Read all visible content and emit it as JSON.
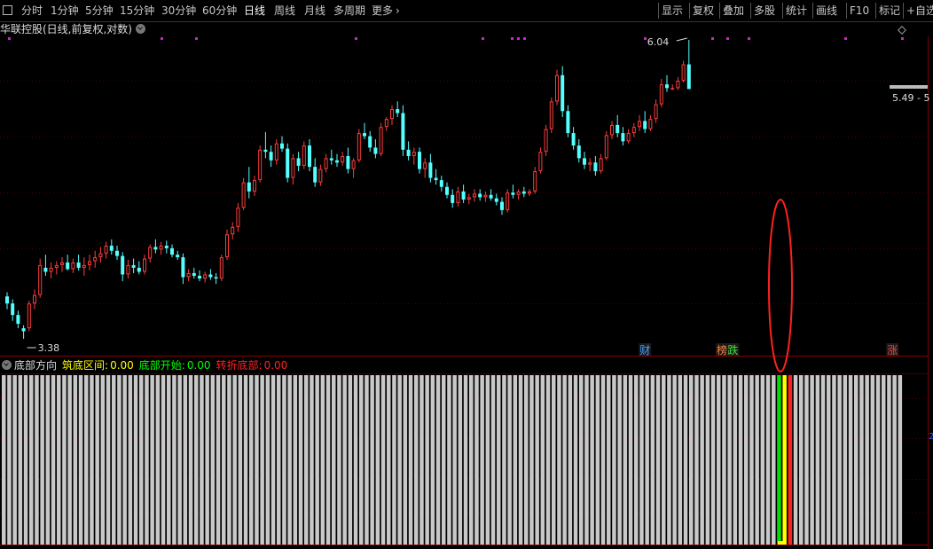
{
  "toolbar": {
    "periods": [
      {
        "label": "分时",
        "active": false
      },
      {
        "label": "1分钟",
        "active": false
      },
      {
        "label": "5分钟",
        "active": false
      },
      {
        "label": "15分钟",
        "active": false
      },
      {
        "label": "30分钟",
        "active": false
      },
      {
        "label": "60分钟",
        "active": false
      },
      {
        "label": "日线",
        "active": true
      },
      {
        "label": "周线",
        "active": false
      },
      {
        "label": "月线",
        "active": false
      },
      {
        "label": "多周期",
        "active": false
      },
      {
        "label": "更多",
        "active": false
      }
    ],
    "tools": [
      "显示",
      "复权",
      "叠加",
      "多股",
      "统计",
      "画线",
      "F10",
      "标记",
      "+自选"
    ]
  },
  "chart_title": "华联控股(日线,前复权,对数)",
  "indicator": {
    "name": "底部方向",
    "items": [
      {
        "label": "筑底区间:",
        "value": "0.00",
        "color": "#ffff00"
      },
      {
        "label": "底部开始:",
        "value": "0.00",
        "color": "#00ff00"
      },
      {
        "label": "转折底部:",
        "value": "0.00",
        "color": "#ff2020"
      }
    ]
  },
  "colors": {
    "up": "#ff3c3c",
    "down": "#54ffff",
    "grid": "#4a0000",
    "marker": "#d020d0"
  },
  "chart_data": {
    "type": "candlestick",
    "log_scale": true,
    "y_min": 3.38,
    "y_max": 6.04,
    "annotations": {
      "low_label": "3.38",
      "high_label": "6.04",
      "price_tag": "5.49 - 5"
    },
    "event_tags": [
      {
        "label": "财",
        "index": 116
      },
      {
        "label": "榜",
        "index": 130
      },
      {
        "label": "跌",
        "index": 132
      },
      {
        "label": "涨",
        "index": 161
      }
    ],
    "candles": [
      [
        3.67,
        3.7,
        3.58,
        3.62
      ],
      [
        3.62,
        3.65,
        3.5,
        3.54
      ],
      [
        3.54,
        3.57,
        3.45,
        3.48
      ],
      [
        3.45,
        3.47,
        3.38,
        3.43
      ],
      [
        3.45,
        3.64,
        3.43,
        3.62
      ],
      [
        3.62,
        3.72,
        3.58,
        3.68
      ],
      [
        3.68,
        3.95,
        3.66,
        3.9
      ],
      [
        3.88,
        3.98,
        3.82,
        3.85
      ],
      [
        3.85,
        3.92,
        3.8,
        3.88
      ],
      [
        3.88,
        3.93,
        3.83,
        3.9
      ],
      [
        3.9,
        3.96,
        3.85,
        3.92
      ],
      [
        3.92,
        3.98,
        3.86,
        3.87
      ],
      [
        3.87,
        3.95,
        3.84,
        3.92
      ],
      [
        3.92,
        3.98,
        3.86,
        3.88
      ],
      [
        3.88,
        3.96,
        3.82,
        3.9
      ],
      [
        3.9,
        3.98,
        3.86,
        3.93
      ],
      [
        3.93,
        4.01,
        3.88,
        3.96
      ],
      [
        3.96,
        4.04,
        3.92,
        3.99
      ],
      [
        3.99,
        4.08,
        3.95,
        4.05
      ],
      [
        4.05,
        4.1,
        3.98,
        4.01
      ],
      [
        4.01,
        4.05,
        3.94,
        3.97
      ],
      [
        3.97,
        4.0,
        3.78,
        3.83
      ],
      [
        3.83,
        3.94,
        3.8,
        3.9
      ],
      [
        3.9,
        3.95,
        3.84,
        3.88
      ],
      [
        3.88,
        3.93,
        3.83,
        3.85
      ],
      [
        3.85,
        3.98,
        3.83,
        3.95
      ],
      [
        3.95,
        4.06,
        3.92,
        4.04
      ],
      [
        4.04,
        4.1,
        3.99,
        4.02
      ],
      [
        4.02,
        4.08,
        3.98,
        4.05
      ],
      [
        4.05,
        4.09,
        3.99,
        4.03
      ],
      [
        4.03,
        4.06,
        3.96,
        3.98
      ],
      [
        3.98,
        4.01,
        3.94,
        3.96
      ],
      [
        3.96,
        3.99,
        3.76,
        3.81
      ],
      [
        3.81,
        3.87,
        3.78,
        3.84
      ],
      [
        3.84,
        3.88,
        3.8,
        3.82
      ],
      [
        3.82,
        3.86,
        3.78,
        3.8
      ],
      [
        3.8,
        3.85,
        3.77,
        3.83
      ],
      [
        3.83,
        3.87,
        3.79,
        3.81
      ],
      [
        3.81,
        3.84,
        3.76,
        3.8
      ],
      [
        3.8,
        3.98,
        3.78,
        3.96
      ],
      [
        3.96,
        4.18,
        3.94,
        4.14
      ],
      [
        4.14,
        4.24,
        4.1,
        4.2
      ],
      [
        4.2,
        4.4,
        4.16,
        4.36
      ],
      [
        4.36,
        4.62,
        4.34,
        4.58
      ],
      [
        4.58,
        4.72,
        4.44,
        4.5
      ],
      [
        4.5,
        4.64,
        4.46,
        4.6
      ],
      [
        4.6,
        4.92,
        4.58,
        4.88
      ],
      [
        4.88,
        5.05,
        4.8,
        4.86
      ],
      [
        4.86,
        4.92,
        4.72,
        4.78
      ],
      [
        4.78,
        4.98,
        4.74,
        4.94
      ],
      [
        4.94,
        5.01,
        4.86,
        4.89
      ],
      [
        4.89,
        4.94,
        4.58,
        4.62
      ],
      [
        4.62,
        4.84,
        4.56,
        4.8
      ],
      [
        4.8,
        4.86,
        4.68,
        4.73
      ],
      [
        4.73,
        4.96,
        4.7,
        4.92
      ],
      [
        4.92,
        4.98,
        4.68,
        4.72
      ],
      [
        4.72,
        4.8,
        4.54,
        4.58
      ],
      [
        4.58,
        4.74,
        4.55,
        4.7
      ],
      [
        4.7,
        4.84,
        4.67,
        4.8
      ],
      [
        4.8,
        4.88,
        4.74,
        4.78
      ],
      [
        4.78,
        4.84,
        4.72,
        4.76
      ],
      [
        4.76,
        4.86,
        4.73,
        4.82
      ],
      [
        4.82,
        4.9,
        4.66,
        4.7
      ],
      [
        4.7,
        4.8,
        4.62,
        4.78
      ],
      [
        4.78,
        5.08,
        4.76,
        5.04
      ],
      [
        5.04,
        5.14,
        4.98,
        5.01
      ],
      [
        5.01,
        5.06,
        4.86,
        4.9
      ],
      [
        4.9,
        4.98,
        4.8,
        4.84
      ],
      [
        4.84,
        5.14,
        4.82,
        5.1
      ],
      [
        5.1,
        5.2,
        5.06,
        5.18
      ],
      [
        5.18,
        5.32,
        5.12,
        5.28
      ],
      [
        5.28,
        5.36,
        5.2,
        5.24
      ],
      [
        5.24,
        5.32,
        4.82,
        4.88
      ],
      [
        4.88,
        4.96,
        4.78,
        4.82
      ],
      [
        4.82,
        4.9,
        4.74,
        4.86
      ],
      [
        4.86,
        4.9,
        4.66,
        4.7
      ],
      [
        4.7,
        4.8,
        4.62,
        4.76
      ],
      [
        4.76,
        4.84,
        4.58,
        4.62
      ],
      [
        4.62,
        4.7,
        4.56,
        4.6
      ],
      [
        4.6,
        4.64,
        4.5,
        4.54
      ],
      [
        4.54,
        4.58,
        4.44,
        4.47
      ],
      [
        4.47,
        4.52,
        4.36,
        4.4
      ],
      [
        4.4,
        4.54,
        4.37,
        4.5
      ],
      [
        4.5,
        4.56,
        4.4,
        4.43
      ],
      [
        4.43,
        4.48,
        4.39,
        4.45
      ],
      [
        4.45,
        4.52,
        4.41,
        4.48
      ],
      [
        4.48,
        4.52,
        4.42,
        4.45
      ],
      [
        4.45,
        4.5,
        4.41,
        4.47
      ],
      [
        4.47,
        4.52,
        4.42,
        4.44
      ],
      [
        4.44,
        4.48,
        4.38,
        4.41
      ],
      [
        4.41,
        4.45,
        4.3,
        4.34
      ],
      [
        4.34,
        4.52,
        4.32,
        4.49
      ],
      [
        4.49,
        4.56,
        4.44,
        4.47
      ],
      [
        4.47,
        4.52,
        4.43,
        4.5
      ],
      [
        4.5,
        4.54,
        4.45,
        4.48
      ],
      [
        4.48,
        4.52,
        4.46,
        4.5
      ],
      [
        4.5,
        4.72,
        4.48,
        4.68
      ],
      [
        4.68,
        4.9,
        4.66,
        4.86
      ],
      [
        4.86,
        5.12,
        4.82,
        5.08
      ],
      [
        5.08,
        5.4,
        5.04,
        5.36
      ],
      [
        5.36,
        5.7,
        5.32,
        5.64
      ],
      [
        5.64,
        5.74,
        5.2,
        5.26
      ],
      [
        5.26,
        5.32,
        5.0,
        5.04
      ],
      [
        5.04,
        5.1,
        4.88,
        4.92
      ],
      [
        4.92,
        4.98,
        4.76,
        4.8
      ],
      [
        4.8,
        4.86,
        4.7,
        4.74
      ],
      [
        4.74,
        4.8,
        4.68,
        4.76
      ],
      [
        4.76,
        4.82,
        4.64,
        4.68
      ],
      [
        4.68,
        4.84,
        4.66,
        4.8
      ],
      [
        4.8,
        5.06,
        4.78,
        5.02
      ],
      [
        5.02,
        5.16,
        4.98,
        5.12
      ],
      [
        5.12,
        5.22,
        5.0,
        5.04
      ],
      [
        5.04,
        5.1,
        4.92,
        4.96
      ],
      [
        4.96,
        5.08,
        4.94,
        5.04
      ],
      [
        5.04,
        5.14,
        5.0,
        5.1
      ],
      [
        5.1,
        5.22,
        5.06,
        5.16
      ],
      [
        5.16,
        5.26,
        5.04,
        5.08
      ],
      [
        5.08,
        5.22,
        5.06,
        5.18
      ],
      [
        5.18,
        5.38,
        5.14,
        5.33
      ],
      [
        5.33,
        5.6,
        5.3,
        5.54
      ],
      [
        5.54,
        5.64,
        5.46,
        5.5
      ],
      [
        5.5,
        5.54,
        5.48,
        5.5
      ],
      [
        5.5,
        5.62,
        5.48,
        5.58
      ],
      [
        5.58,
        5.8,
        5.56,
        5.76
      ],
      [
        5.76,
        6.04,
        5.74,
        5.49
      ]
    ]
  }
}
